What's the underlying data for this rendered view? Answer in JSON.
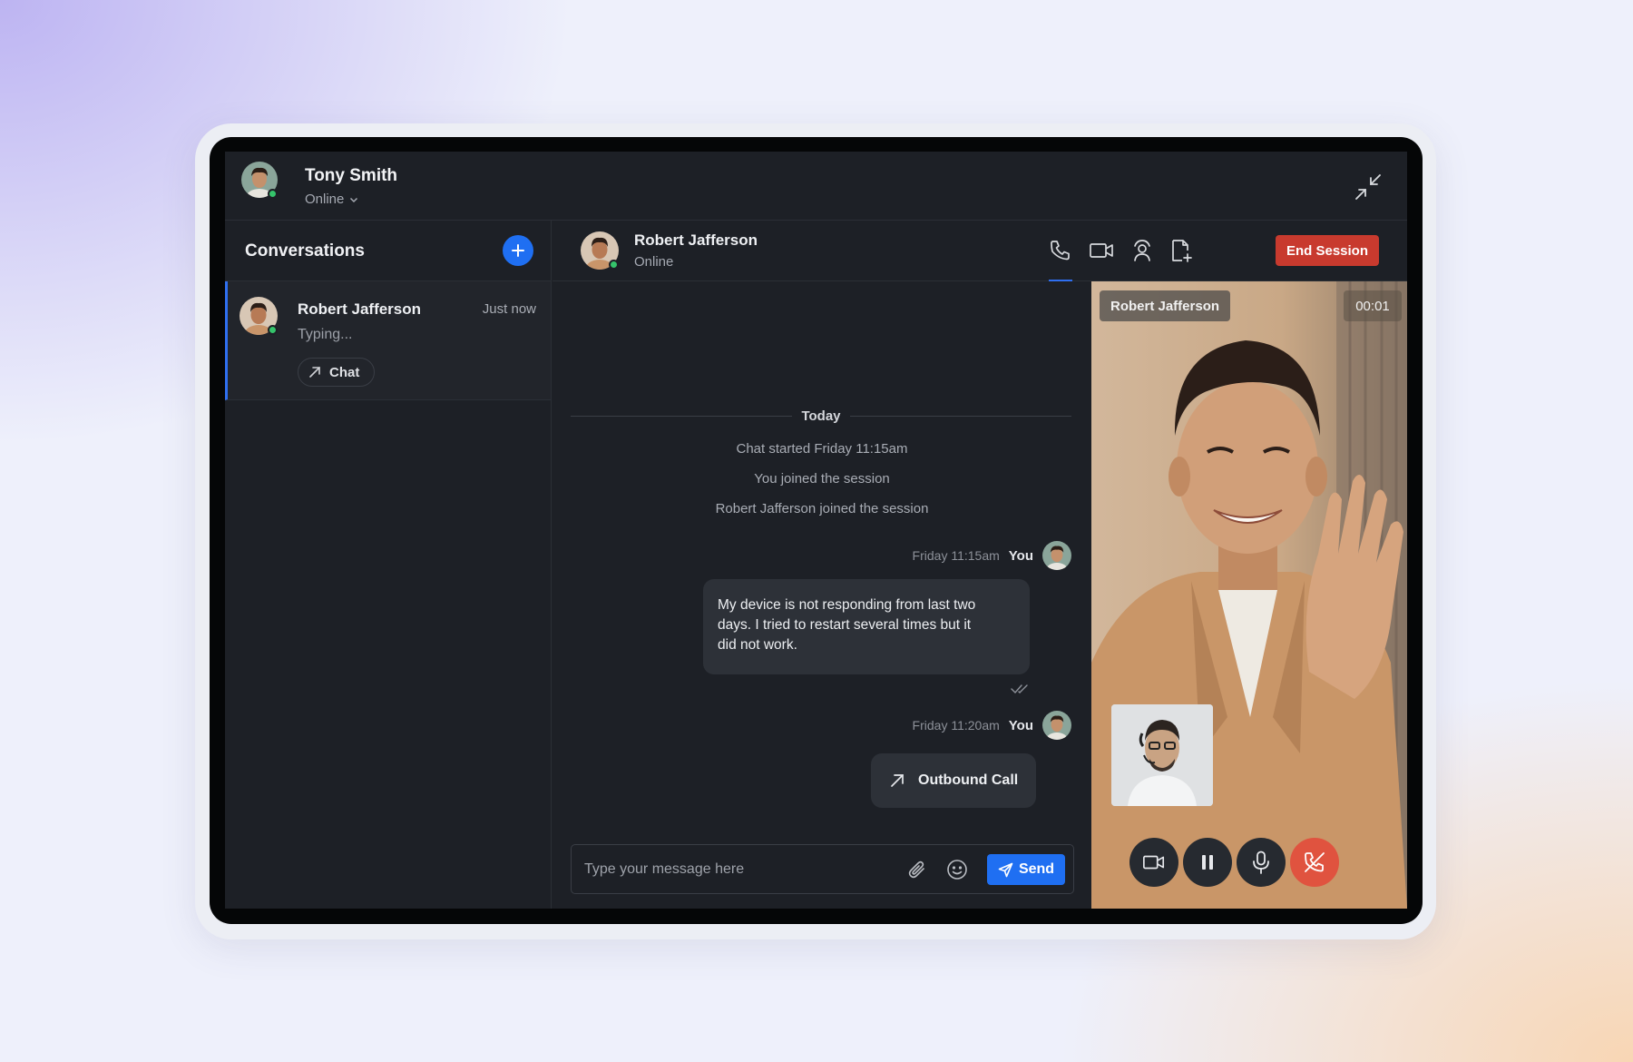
{
  "user": {
    "name": "Tony Smith",
    "status": "Online"
  },
  "sidebar": {
    "title": "Conversations",
    "conversations": [
      {
        "name": "Robert Jafferson",
        "time": "Just now",
        "preview": "Typing...",
        "chip": "Chat"
      }
    ]
  },
  "chat": {
    "contact_name": "Robert Jafferson",
    "contact_status": "Online",
    "end_session_label": "End Session",
    "day_label": "Today",
    "system_messages": [
      "Chat  started Friday 11:15am",
      "You joined the session",
      "Robert Jafferson joined the session"
    ],
    "messages": [
      {
        "time": "Friday 11:15am",
        "sender": "You",
        "text": "My device is not responding from last two days. I tried to restart several times but it did not work."
      },
      {
        "time": "Friday 11:20am",
        "sender": "You",
        "call_label": "Outbound Call"
      }
    ],
    "composer": {
      "placeholder": "Type your message here",
      "send_label": "Send"
    }
  },
  "video": {
    "participant_name": "Robert Jafferson",
    "timer": "00:01"
  },
  "colors": {
    "accent": "#1f6ff2",
    "danger": "#c83a2e",
    "online": "#35c46b",
    "app_bg": "#1d2026"
  },
  "icons": [
    "collapse-icon",
    "plus-icon",
    "arrow-up-right-icon",
    "phone-icon",
    "video-camera-icon",
    "screen-share-person-icon",
    "file-add-icon",
    "paperclip-icon",
    "emoji-icon",
    "send-icon",
    "double-check-icon",
    "pause-icon",
    "microphone-icon",
    "phone-hangup-icon",
    "chevron-down-icon"
  ]
}
